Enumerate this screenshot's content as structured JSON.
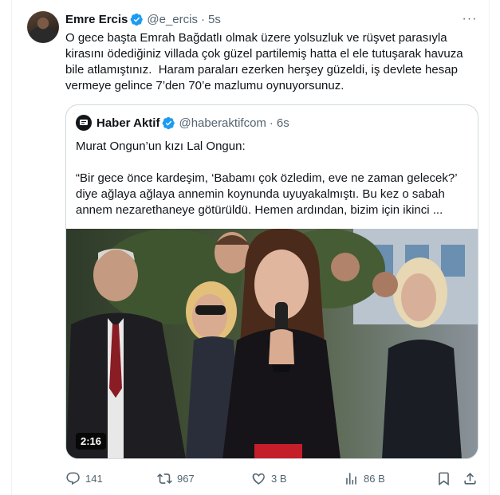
{
  "tweet": {
    "author_name": "Emre Ercis",
    "handle": "@e_ercis",
    "separator": "·",
    "time": "5s",
    "more_label": "···",
    "text": "O gece başta Emrah Bağdatlı olmak üzere yolsuzluk ve rüşvet parasıyla kirasını ödediğiniz villada çok güzel partilemiş hatta el ele tutuşarak havuza bile atlamıştınız.  Haram paraları ezerken herşey güzeldi, iş devlete hesap vermeye gelince 7’den 70’e mazlumu oynuyorsunuz."
  },
  "quoted": {
    "author_name": "Haber Aktif",
    "handle": "@haberaktifcom",
    "separator": "·",
    "time": "6s",
    "text": "Murat Ongun’un kızı Lal Ongun:\n\n“Bir gece önce kardeşim, ‘Babamı çok özledim, eve ne zaman gelecek?’ diye ağlaya ağlaya annemin koynunda uyuyakalmıştı. Bu kez o sabah annem nezarethaneye götürüldü. Hemen ardından, bizim için ikinci ...",
    "video_duration": "2:16"
  },
  "actions": {
    "replies": "141",
    "reposts": "967",
    "likes": "3 B",
    "views": "86 B"
  },
  "colors": {
    "verified": "#1d9bf0",
    "secondary_text": "#536471",
    "border": "#cfd9de"
  },
  "icons": [
    "verified-badge-icon",
    "more-icon",
    "reply-icon",
    "repost-icon",
    "like-icon",
    "views-icon",
    "bookmark-icon",
    "share-icon"
  ]
}
